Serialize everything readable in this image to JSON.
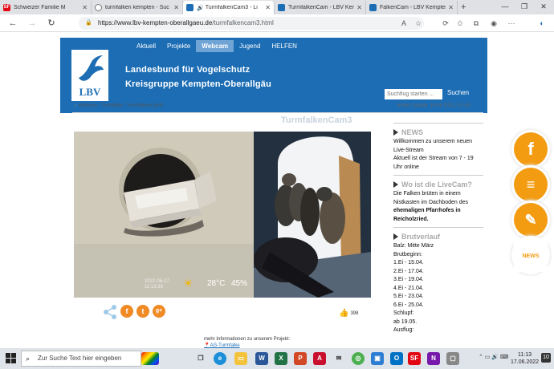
{
  "browser": {
    "tabs": [
      {
        "label": "Schweizer Familie M",
        "icon": "sf-icon",
        "color": "#e30613",
        "active": false
      },
      {
        "label": "turmfalken kempten - Suc",
        "icon": "search-icon",
        "color": "#555555",
        "active": false
      },
      {
        "label": "TurmfalkenCam3 - Li",
        "icon": "bird-icon",
        "color": "#1c6db4",
        "active": true
      },
      {
        "label": "TurmfalkenCam - LBV Kem",
        "icon": "bird-icon",
        "color": "#1c6db4",
        "active": false
      },
      {
        "label": "FalkenCam - LBV Kempten",
        "icon": "bird-icon",
        "color": "#1c6db4",
        "active": false
      }
    ],
    "url": "https://www.lbv-kempten-oberallgaeu.de/turmfalkencam3.html",
    "url_domain": "https://www.lbv-kempten-oberallgaeu.de",
    "url_path": "/turmfalkencam3.html"
  },
  "site": {
    "nav": [
      "Aktuell",
      "Projekte",
      "Webcam",
      "Jugend",
      "HELFEN"
    ],
    "selected_nav": "Webcam",
    "logo_text": "LBV",
    "title_line1": "Landesbund für Vogelschutz",
    "title_line2": "Kreisgruppe Kempten-Oberallgäu",
    "search_placeholder": "Suchflug starten ...",
    "search_button": "Suchen",
    "breadcrumb": "Webcam / Turmfalke / TurmfalkenCam3",
    "updated": "letztes Update: 16.06.2022 / 12:43",
    "accent": "#1c6db4"
  },
  "cam": {
    "title": "TurmfalkenCam3",
    "timestamp_date": "2022-06-17",
    "timestamp_time": "11:13:30",
    "temp_celsius": "28°C",
    "humidity": "45%"
  },
  "social": {
    "share_icon": "share-icon",
    "facebook": "f",
    "twitter": "t",
    "googleplus": "g+",
    "likes": "398"
  },
  "project": {
    "info": "mehr Informationen zu unserem Projekt:",
    "link": "AG-Turmfalke"
  },
  "sidebar": {
    "news_head": "NEWS",
    "news_text": [
      "Willkommen zu unserem neuen",
      "Live-Stream",
      "Aktuell ist der Stream von 7 - 19",
      "Uhr online"
    ],
    "live_head": "Wo ist die LiveCam?",
    "live_text_plain": [
      "Die Falken brüten in einem",
      "Nistkasten im Dachboden des"
    ],
    "live_text_bold": [
      "ehemaligen Pfarrhofes in",
      "Reicholzried."
    ],
    "brut_head": "Brutverlauf",
    "brut_lines": [
      "Balz: Mitte März",
      "Brutbeginn:",
      "1.Ei - 15.04.",
      "2.Ei - 17.04.",
      "3.Ei - 19.04.",
      "4.Ei - 21.04.",
      "5.Ei - 23.04.",
      "6.Ei - 25.04.",
      "Schlupf:",
      "ab 19.05.",
      "Ausflug:"
    ]
  },
  "float_icons": [
    "facebook-icon",
    "list-icon",
    "pen-icon",
    "news-icon"
  ],
  "float_news_label": "NEWS",
  "taskbar": {
    "search_placeholder": "Zur Suche Text hier eingeben",
    "time": "11:13",
    "date": "17.06.2022"
  }
}
